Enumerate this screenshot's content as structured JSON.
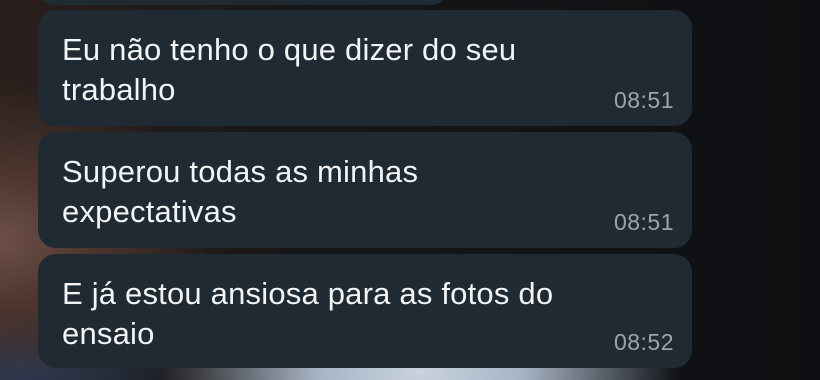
{
  "messages": [
    {
      "text": "Eu não tenho o que dizer do seu trabalho",
      "time": "08:51"
    },
    {
      "text": "Superou todas as minhas expectativas",
      "time": "08:51"
    },
    {
      "text": "E já estou ansiosa para as fotos do ensaio",
      "time": "08:52"
    }
  ]
}
